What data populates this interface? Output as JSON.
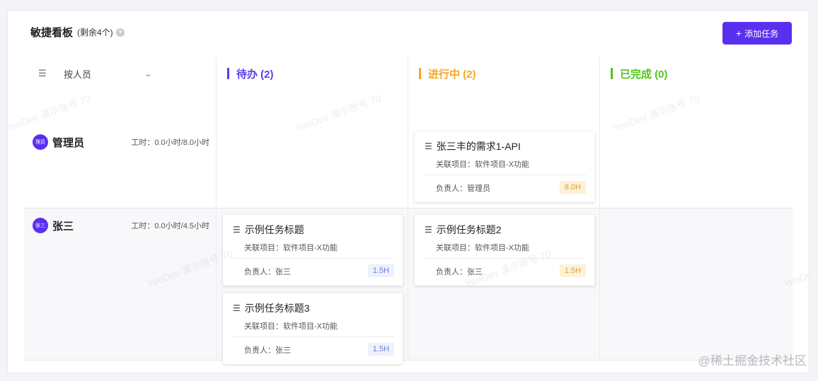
{
  "header": {
    "title": "敏捷看板",
    "remaining": "(剩余4个)",
    "help_icon": "question-circle-icon",
    "add_button": "添加任务"
  },
  "grouping": {
    "label": "按人员"
  },
  "columns": [
    {
      "name": "待办 (2)",
      "color": "#5a3df0"
    },
    {
      "name": "进行中 (2)",
      "color": "#f5a623"
    },
    {
      "name": "已完成 (0)",
      "color": "#52c41a"
    }
  ],
  "rows": [
    {
      "avatar": "理员",
      "name": "管理员",
      "hours": "工时：0.0小时/8.0小时"
    },
    {
      "avatar": "张三",
      "name": "张三",
      "hours": "工时：0.0小时/4.5小时"
    }
  ],
  "cards": [
    {
      "title": "张三丰的需求1-API",
      "project": "关联项目：软件项目-X功能",
      "owner": "负责人：管理员",
      "hours": "8.0H",
      "tag_color": "orange"
    },
    {
      "title": "示例任务标题",
      "project": "关联项目：软件项目-X功能",
      "owner": "负责人：张三",
      "hours": "1.5H",
      "tag_color": "blue"
    },
    {
      "title": "示例任务标题3",
      "project": "关联项目：软件项目-X功能",
      "owner": "负责人：张三",
      "hours": "1.5H",
      "tag_color": "blue"
    },
    {
      "title": "示例任务标题2",
      "project": "关联项目：软件项目-X功能",
      "owner": "负责人：张三",
      "hours": "1.5H",
      "tag_color": "orange"
    }
  ],
  "watermark": "YeeDev 演示账号 70",
  "footer_brand": "@稀土掘金技术社区"
}
